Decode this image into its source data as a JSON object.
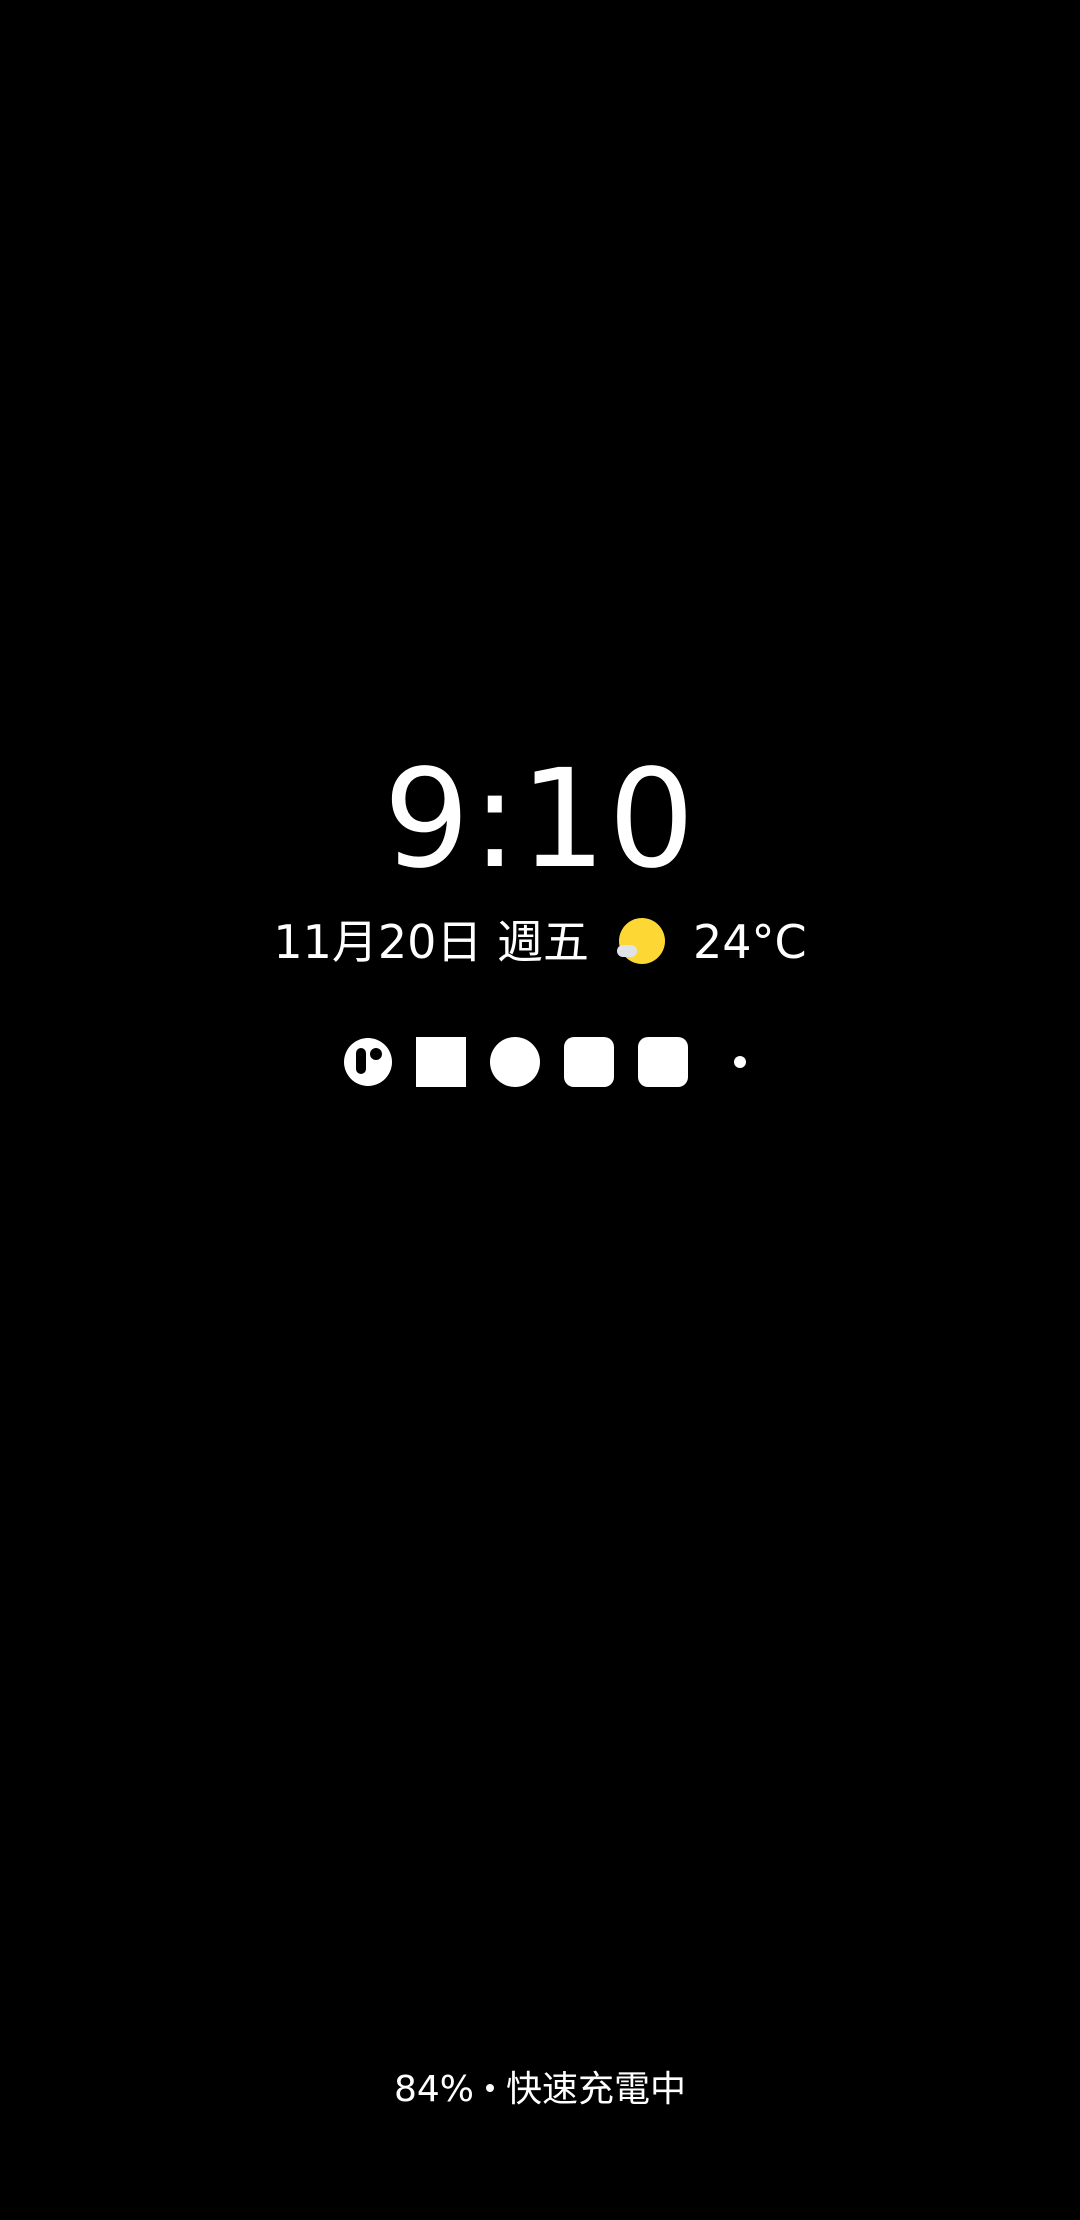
{
  "lockscreen": {
    "time": "9:10",
    "date": "11月20日 週五",
    "temperature": "24°C",
    "weather_icon": "sunny-partly-cloudy-icon",
    "notification_icons": [
      "app-icon",
      "square-icon",
      "circle-icon",
      "rounded-square-icon",
      "rounded-square-icon",
      "more-dot-icon"
    ],
    "battery_percent": "84%",
    "charging_status": "快速充電中"
  },
  "colors": {
    "background": "#000000",
    "text": "#ffffff",
    "sun": "#fdd835"
  }
}
